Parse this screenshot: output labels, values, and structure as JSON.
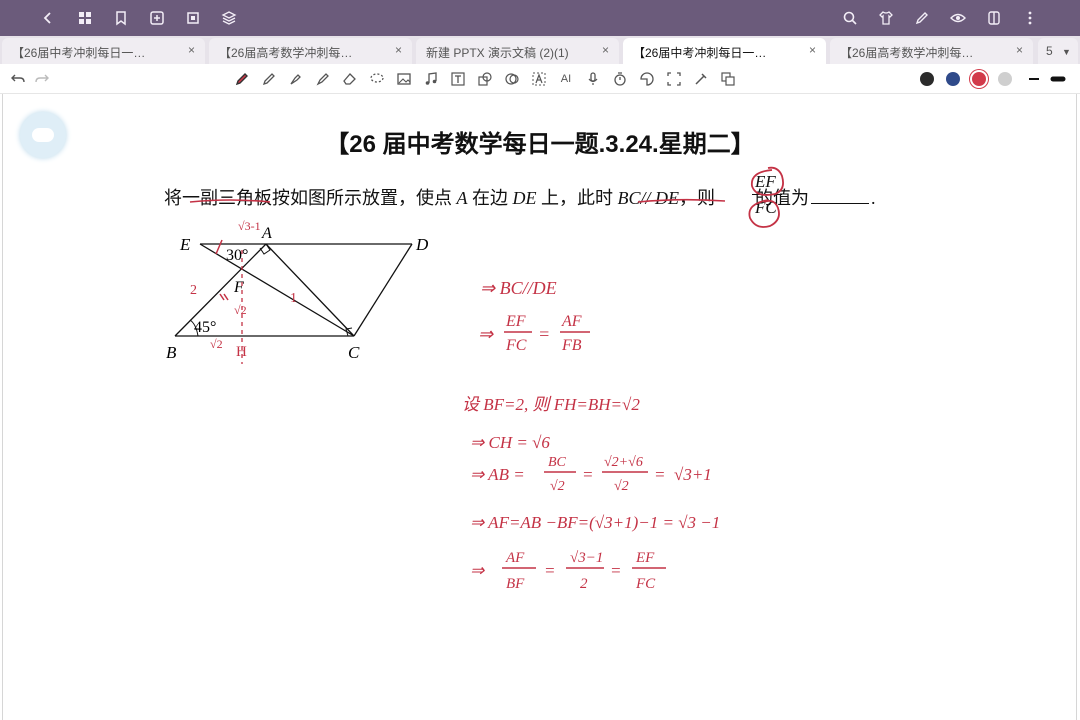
{
  "appbar": {
    "left_icons": [
      "back-icon",
      "grid-icon",
      "bookmark-icon",
      "add-page-icon",
      "crop-icon",
      "layers-icon"
    ],
    "right_icons": [
      "search-icon",
      "shirt-icon",
      "pen-edit-icon",
      "eye-icon",
      "panel-icon",
      "more-vertical-icon"
    ]
  },
  "tabs": [
    {
      "label": "【26届中考冲刺每日一…",
      "close": "×"
    },
    {
      "label": "【26届高考数学冲刺每…",
      "close": "×"
    },
    {
      "label": "新建 PPTX 演示文稿 (2)(1)",
      "close": "×"
    },
    {
      "label": "【26届中考冲刺每日一…",
      "close": "×"
    },
    {
      "label": "【26届高考数学冲刺每…",
      "close": "×"
    }
  ],
  "tab_count": "5",
  "toolbar": {
    "ai_label": "AI",
    "colors": [
      "#2b2b2b",
      "#2f4a8a",
      "#d23a4a",
      "#cfcfcf"
    ]
  },
  "document": {
    "title": "【26 届中考数学每日一题.3.24.星期二】",
    "problem": {
      "part1": "将一副三角板按如图所示放置，使点 ",
      "A": "A",
      "part2": " 在边 ",
      "DE": "DE",
      "part3": " 上，此时 ",
      "BC_DE": "BC// DE",
      "part4": "，则",
      "part5": "的值为",
      "end": "."
    },
    "fraction": {
      "num": "EF",
      "den": "FC"
    },
    "figure_labels": {
      "E": "E",
      "A": "A",
      "D": "D",
      "F": "F",
      "B": "B",
      "C": "C",
      "angle30": "30°",
      "angle45": "45°"
    },
    "annotations": {
      "near_A": "√3-1",
      "edge_BF": "2",
      "edge_AC": "1",
      "bottom_FH": "√2",
      "near_B": "√2",
      "H": "H"
    },
    "work": {
      "l1": "⇒ BC//DE",
      "l2": "⇒",
      "l2_fracs": [
        "EF",
        "FC",
        "AF",
        "FB"
      ],
      "l3": "设 BF=2, 则 FH=BH=√2",
      "l4": "⇒ CH = √6",
      "l5": "⇒ AB =",
      "l5_rest": [
        "BC",
        "√2",
        "√2+√6",
        "√2",
        "√3+1"
      ],
      "l6": "⇒ AF=AB −BF=(√3+1)−1 = √3 −1",
      "l7": "⇒",
      "l7_fracs": [
        "AF",
        "BF",
        "√3−1",
        "2",
        "EF",
        "FC"
      ]
    }
  }
}
